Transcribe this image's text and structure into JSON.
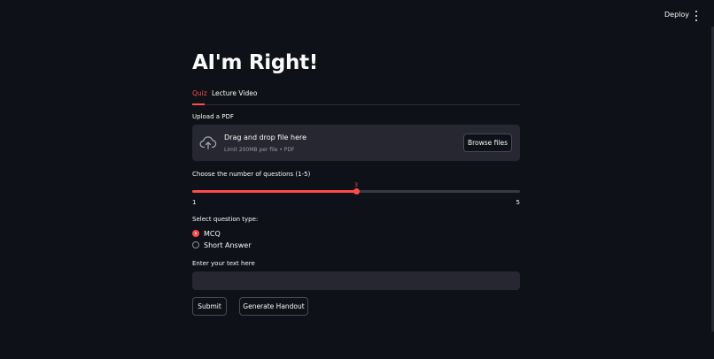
{
  "header": {
    "deploy_label": "Deploy",
    "menu_icon": "kebab-menu-icon"
  },
  "page": {
    "title": "AI'm Right!"
  },
  "tabs": [
    {
      "label": "Quiz",
      "active": true
    },
    {
      "label": "Lecture Video",
      "active": false
    }
  ],
  "upload": {
    "label": "Upload a PDF",
    "icon": "cloud-upload-icon",
    "dropzone_title": "Drag and drop file here",
    "dropzone_subtitle": "Limit 200MB per file • PDF",
    "browse_label": "Browse files"
  },
  "slider": {
    "label": "Choose the number of questions (1-5)",
    "min": 1,
    "max": 5,
    "value": 3,
    "min_label": "1",
    "max_label": "5",
    "value_label": "3"
  },
  "question_type": {
    "label": "Select question type:",
    "options": [
      {
        "label": "MCQ",
        "checked": true
      },
      {
        "label": "Short Answer",
        "checked": false
      }
    ]
  },
  "text_input": {
    "label": "Enter your text here",
    "value": ""
  },
  "buttons": {
    "submit_label": "Submit",
    "handout_label": "Generate Handout"
  },
  "colors": {
    "background": "#0e1117",
    "accent": "#ff4b4b",
    "widget_bg": "#262730",
    "text": "#fafafa"
  }
}
